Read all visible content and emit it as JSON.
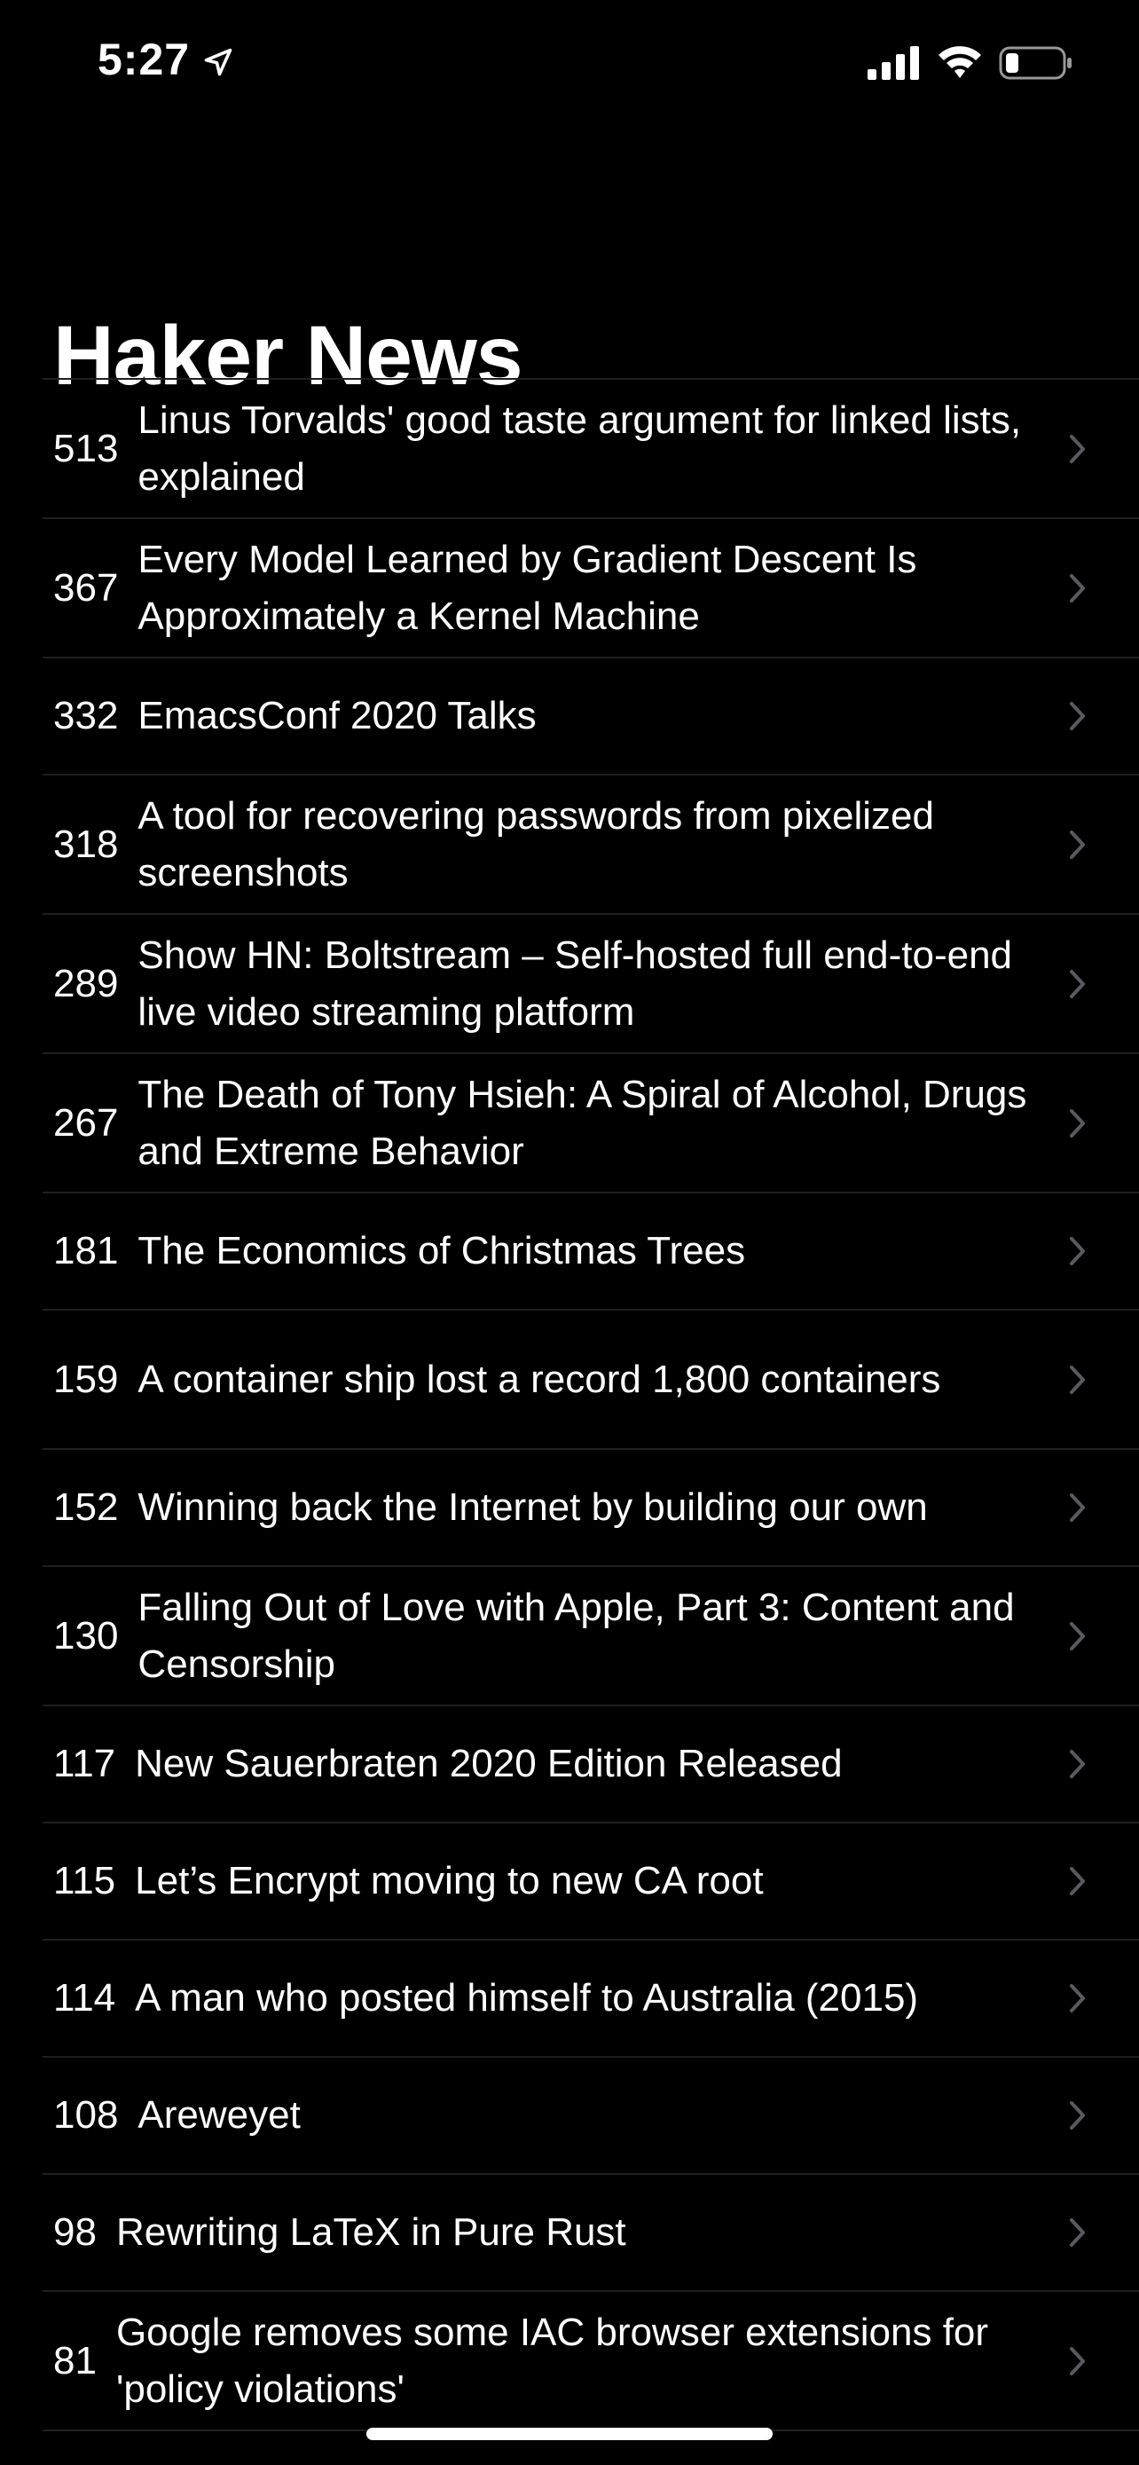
{
  "status_bar": {
    "time": "5:27",
    "icons": [
      "location-arrow-icon",
      "cellular-signal-icon",
      "wifi-icon",
      "battery-icon"
    ]
  },
  "header": {
    "title": "Haker News"
  },
  "stories": [
    {
      "points": "513",
      "title": "Linus Torvalds' good taste argument for linked lists, explained"
    },
    {
      "points": "367",
      "title": "Every Model Learned by Gradient Descent Is Approximately a Kernel Machine"
    },
    {
      "points": "332",
      "title": "EmacsConf 2020 Talks"
    },
    {
      "points": "318",
      "title": "A tool for recovering passwords from pixelized screenshots"
    },
    {
      "points": "289",
      "title": "Show HN: Boltstream – Self-hosted full end-to-end live video streaming platform"
    },
    {
      "points": "267",
      "title": "The Death of Tony Hsieh: A Spiral of Alcohol, Drugs and Extreme Behavior"
    },
    {
      "points": "181",
      "title": "The Economics of Christmas Trees"
    },
    {
      "points": "159",
      "title": "A container ship lost a record 1,800 containers"
    },
    {
      "points": "152",
      "title": "Winning back the Internet by building our own"
    },
    {
      "points": "130",
      "title": "Falling Out of Love with Apple, Part 3: Content and Censorship"
    },
    {
      "points": "117",
      "title": "New Sauerbraten 2020 Edition Released"
    },
    {
      "points": "115",
      "title": "Let’s Encrypt moving to new CA root"
    },
    {
      "points": "114",
      "title": "A man who posted himself to Australia (2015)"
    },
    {
      "points": "108",
      "title": "Areweyet"
    },
    {
      "points": "98",
      "title": "Rewriting LaTeX in Pure Rust"
    },
    {
      "points": "81",
      "title": "Google removes some IAC browser extensions for 'policy violations'"
    }
  ],
  "colors": {
    "background": "#000000",
    "text": "#ffffff",
    "separator": "#1f1f1f",
    "chevron": "#5a5a5e"
  }
}
